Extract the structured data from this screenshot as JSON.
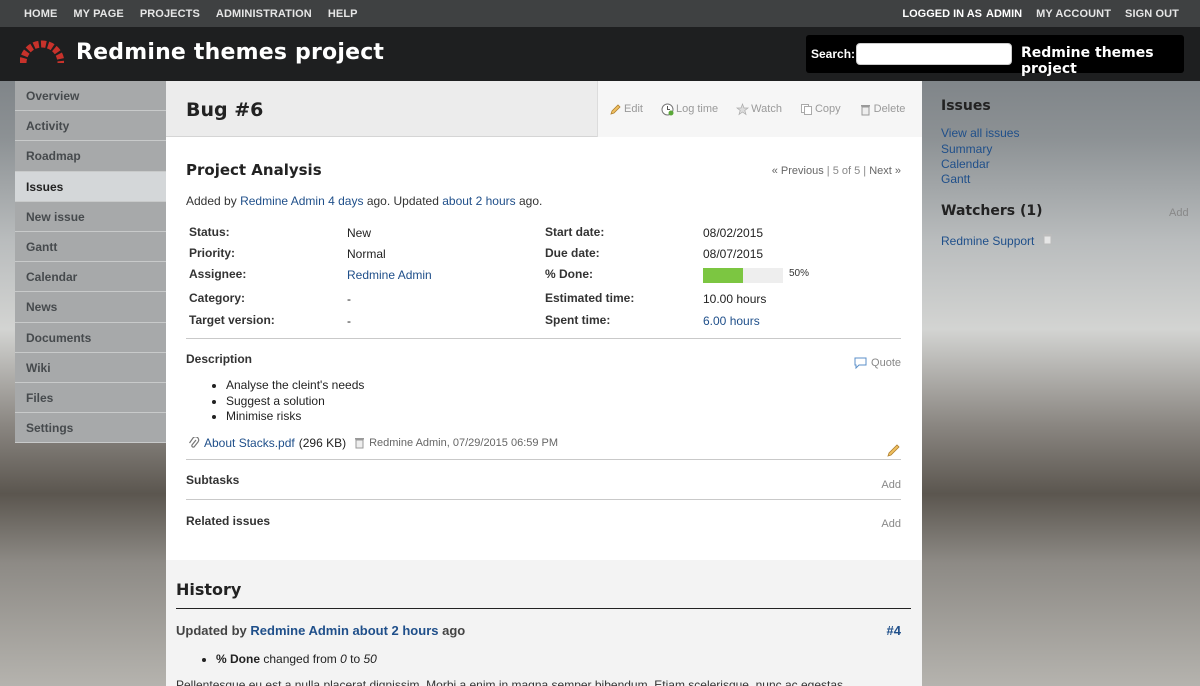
{
  "top_menu": {
    "home": "HOME",
    "my_page": "MY PAGE",
    "projects": "PROJECTS",
    "administration": "ADMINISTRATION",
    "help": "HELP",
    "logged_in_as": "LOGGED IN AS",
    "user": "ADMIN",
    "my_account": "MY ACCOUNT",
    "sign_out": "SIGN OUT"
  },
  "header": {
    "title": "Redmine themes project",
    "search_label": "Search:",
    "search_value": "",
    "project_jump": "Redmine themes project"
  },
  "main_menu": [
    {
      "label": "Overview"
    },
    {
      "label": "Activity"
    },
    {
      "label": "Roadmap"
    },
    {
      "label": "Issues",
      "selected": true
    },
    {
      "label": "New issue"
    },
    {
      "label": "Gantt"
    },
    {
      "label": "Calendar"
    },
    {
      "label": "News"
    },
    {
      "label": "Documents"
    },
    {
      "label": "Wiki"
    },
    {
      "label": "Files"
    },
    {
      "label": "Settings"
    }
  ],
  "issue": {
    "heading": "Bug #6",
    "actions": {
      "edit": "Edit",
      "log_time": "Log time",
      "watch": "Watch",
      "copy": "Copy",
      "delete": "Delete"
    },
    "subject": "Project Analysis",
    "pagination": {
      "previous": "« Previous",
      "position": "5 of 5",
      "next": "Next »"
    },
    "author": {
      "added_by": "Added by",
      "author_name": "Redmine Admin",
      "created": "4 days",
      "ago_updated": "ago. Updated",
      "updated": "about 2 hours",
      "ago": "ago."
    },
    "attributes": {
      "status_label": "Status:",
      "status": "New",
      "priority_label": "Priority:",
      "priority": "Normal",
      "assignee_label": "Assignee:",
      "assignee": "Redmine Admin",
      "category_label": "Category:",
      "category": "-",
      "target_version_label": "Target version:",
      "target_version": "-",
      "start_date_label": "Start date:",
      "start_date": "08/02/2015",
      "due_date_label": "Due date:",
      "due_date": "08/07/2015",
      "done_label": "% Done:",
      "done": "50%",
      "done_ratio": 0.5,
      "estimated_label": "Estimated time:",
      "estimated": "10.00 hours",
      "spent_label": "Spent time:",
      "spent": "6.00 hours"
    },
    "description": {
      "title": "Description",
      "quote": "Quote",
      "items": [
        "Analyse the cleint's needs",
        "Suggest a solution",
        "Minimise risks"
      ]
    },
    "attachment": {
      "filename": "About Stacks.pdf",
      "size": "(296 KB)",
      "meta": "Redmine Admin, 07/29/2015 06:59 PM"
    },
    "subtasks": {
      "title": "Subtasks",
      "add": "Add"
    },
    "related": {
      "title": "Related issues",
      "add": "Add"
    }
  },
  "history": {
    "title": "History",
    "journal": {
      "updated_by": "Updated by",
      "user": "Redmine Admin",
      "when": "about 2 hours",
      "ago": "ago",
      "number": "#4",
      "detail_field": "% Done",
      "detail_changed": "changed from",
      "detail_from": "0",
      "detail_to_word": "to",
      "detail_to": "50",
      "text": "Pellentesque eu est a nulla placerat dignissim. Morbi a enim in magna semper bibendum. Etiam scelerisque, nunc ac egestas"
    }
  },
  "sidebar": {
    "issues_title": "Issues",
    "view_all": "View all issues",
    "summary": "Summary",
    "calendar": "Calendar",
    "gantt": "Gantt",
    "watchers_title": "Watchers (1)",
    "watchers_add": "Add",
    "watcher": "Redmine Support"
  },
  "colors": {
    "top_menu_bg": "#3f4142",
    "header_bg": "#1e1f20",
    "link": "#1f4f8a",
    "progress_fill": "#7cc641",
    "logo_red": "#c8322b"
  },
  "icons": [
    "redmine-logo-icon",
    "edit-icon",
    "clock-icon",
    "star-icon",
    "copy-icon",
    "trash-icon",
    "comment-icon",
    "paperclip-icon",
    "pencil-icon"
  ]
}
